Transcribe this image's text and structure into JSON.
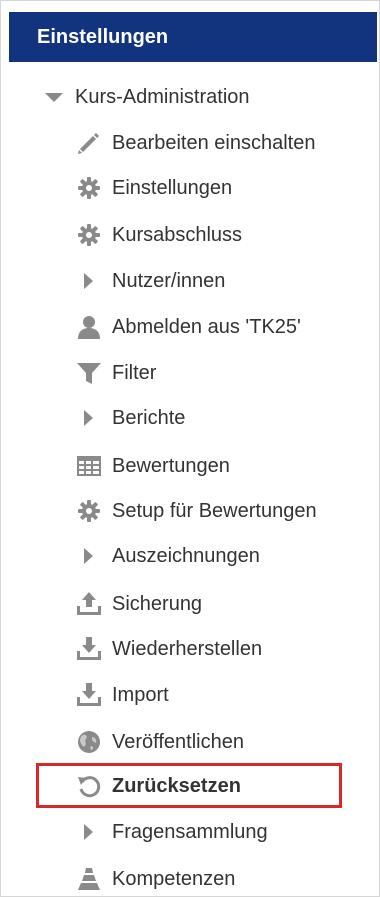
{
  "panel": {
    "title": "Einstellungen"
  },
  "tree": {
    "root_label": "Kurs-Administration",
    "items": [
      {
        "label": "Bearbeiten einschalten",
        "icon": "pencil-icon"
      },
      {
        "label": "Einstellungen",
        "icon": "gear-icon"
      },
      {
        "label": "Kursabschluss",
        "icon": "gear-icon"
      },
      {
        "label": "Nutzer/innen",
        "icon": "expand-arrow-icon"
      },
      {
        "label": "Abmelden aus 'TK25'",
        "icon": "user-icon"
      },
      {
        "label": "Filter",
        "icon": "filter-icon"
      },
      {
        "label": "Berichte",
        "icon": "expand-arrow-icon"
      },
      {
        "label": "Bewertungen",
        "icon": "table-icon"
      },
      {
        "label": "Setup für Bewertungen",
        "icon": "gear-icon"
      },
      {
        "label": "Auszeichnungen",
        "icon": "expand-arrow-icon"
      },
      {
        "label": "Sicherung",
        "icon": "upload-icon"
      },
      {
        "label": "Wiederherstellen",
        "icon": "download-icon"
      },
      {
        "label": "Import",
        "icon": "download-icon"
      },
      {
        "label": "Veröffentlichen",
        "icon": "globe-icon"
      },
      {
        "label": "Zurücksetzen",
        "icon": "reset-icon"
      },
      {
        "label": "Fragensammlung",
        "icon": "expand-arrow-icon"
      },
      {
        "label": "Kompetenzen",
        "icon": "competency-icon"
      }
    ]
  },
  "colors": {
    "header_bg": "#12347e",
    "header_text": "#ffffff",
    "icon_gray": "#8a8a8a",
    "highlight_border": "#d42a2a",
    "text": "#333333"
  }
}
